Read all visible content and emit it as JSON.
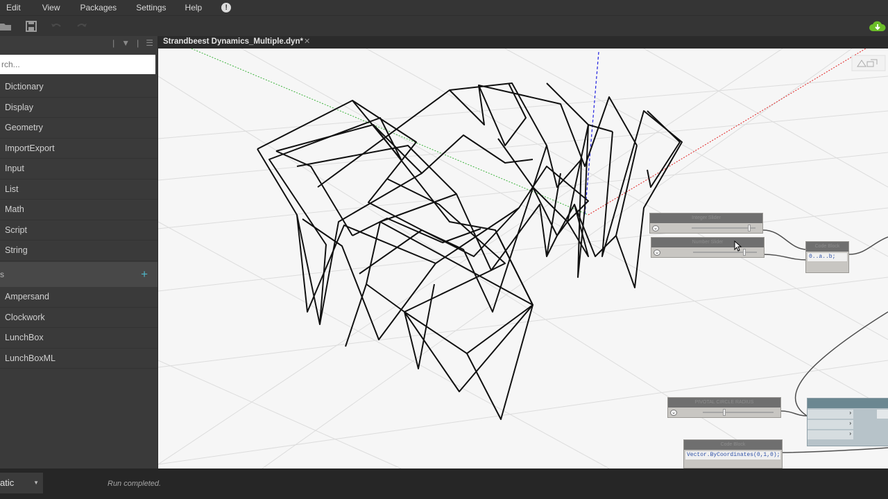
{
  "menu": {
    "items": [
      "Edit",
      "View",
      "Packages",
      "Settings",
      "Help"
    ],
    "help_badge": "!"
  },
  "toolbar": {
    "icons": [
      "open-icon",
      "save-icon",
      "undo-icon",
      "redo-icon",
      "cloud-download-icon"
    ],
    "cloud_color": "#6bbd29"
  },
  "library": {
    "search_placeholder": "rch...",
    "header_icons": [
      "layout-icon",
      "filter-icon",
      "list-view-icon"
    ],
    "categories": [
      "Dictionary",
      "Display",
      "Geometry",
      "ImportExport",
      "Input",
      "List",
      "Math",
      "Script",
      "String"
    ],
    "addons_label": "s",
    "addons_add": "+",
    "packages": [
      "Ampersand",
      "Clockwork",
      "LunchBox",
      "LunchBoxML"
    ]
  },
  "tab": {
    "file_name": "Strandbeest Dynamics_Multiple.dyn*",
    "close": "✕"
  },
  "nodes": {
    "slider_a": {
      "title": "Integer Slider",
      "value_fraction": 0.9
    },
    "slider_b": {
      "title": "Number Slider",
      "value_fraction": 0.8
    },
    "code_block_1": {
      "title": "Code Block",
      "code": "0..a..b;"
    },
    "slider_c": {
      "title": "PIVOTAL CIRCLE RADIUS",
      "value_fraction": 0.3
    },
    "code_block_2": {
      "title": "Code Block",
      "code": "Vector.ByCoordinates(0,1,0);"
    }
  },
  "status": {
    "run_mode": "atic",
    "message": "Run completed."
  },
  "colors": {
    "menubar": "#353535",
    "canvas": "#f6f6f6",
    "axis_x": "#e02020",
    "axis_y": "#20a020",
    "axis_z": "#2020e0",
    "accent": "#4fb6c8"
  }
}
